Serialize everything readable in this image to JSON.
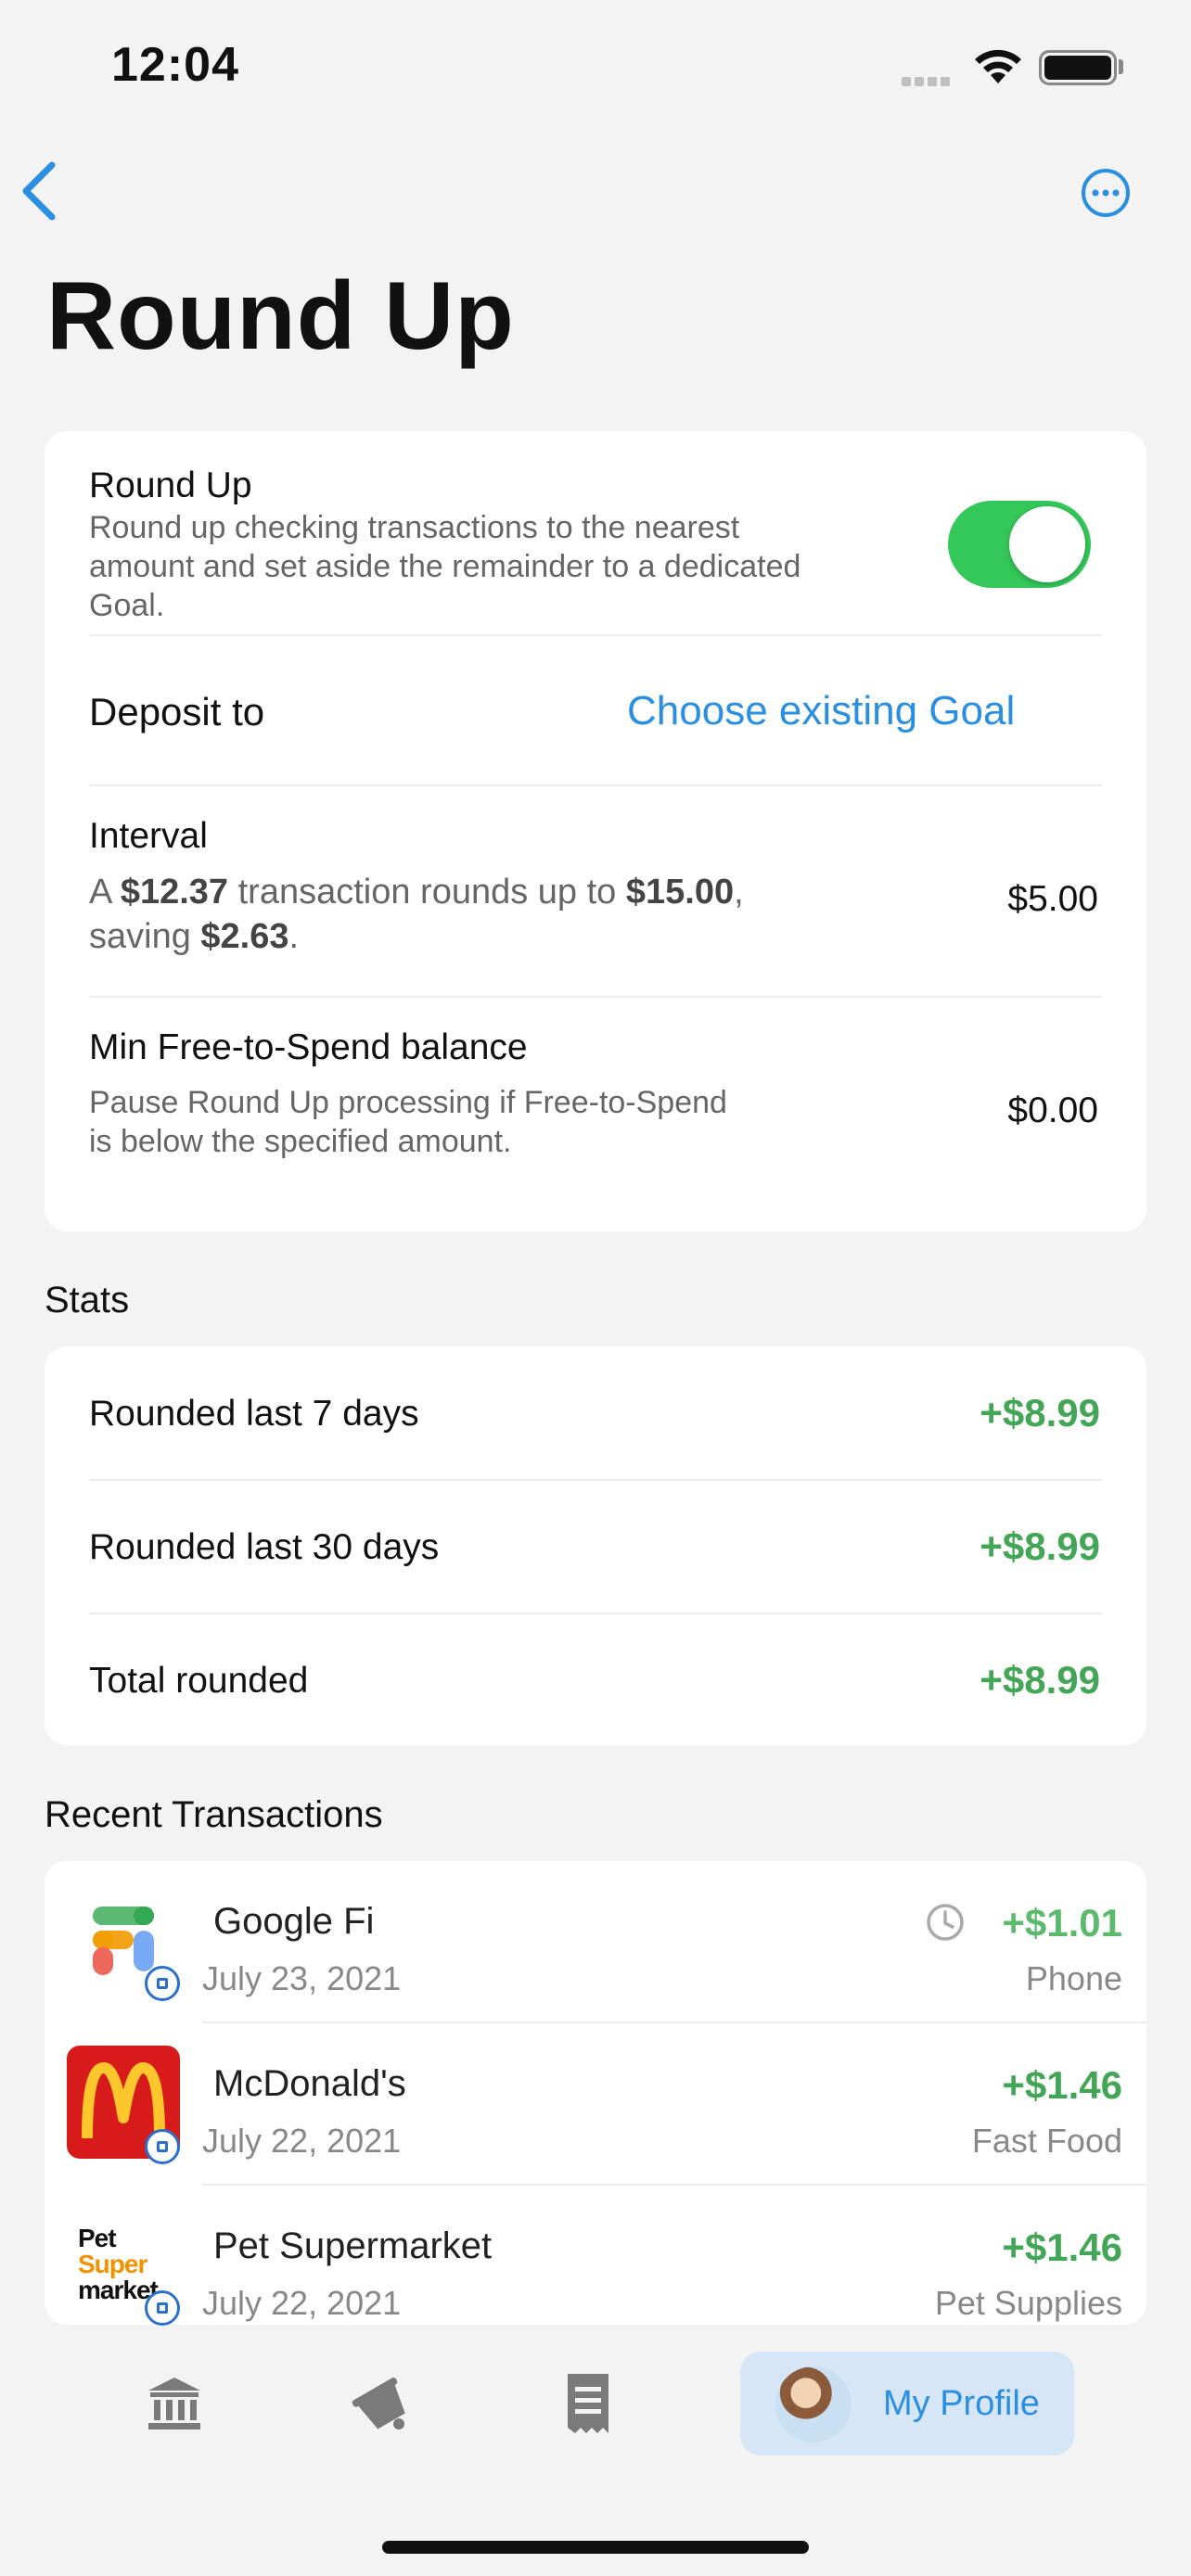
{
  "status_bar": {
    "time": "12:04"
  },
  "nav": {
    "title": "Round Up"
  },
  "settings": {
    "round_up_label": "Round Up",
    "round_up_desc_1": "Round up checking transactions to the nearest",
    "round_up_desc_2": "amount and set aside the remainder to a dedicated",
    "round_up_desc_3": "Goal.",
    "round_up_enabled": true,
    "deposit_label": "Deposit to",
    "deposit_link": "Choose existing Goal",
    "interval_label": "Interval",
    "interval_desc_a": "A",
    "interval_desc_amt1": "$12.37",
    "interval_desc_b": "transaction rounds up to",
    "interval_desc_amt2": "$15.00",
    "interval_desc_c": ",",
    "interval_desc_d": "saving",
    "interval_desc_amt3": "$2.63",
    "interval_desc_e": ".",
    "interval_value": "$5.00",
    "min_label": "Min Free-to-Spend balance",
    "min_desc_1": "Pause Round Up processing if Free-to-Spend",
    "min_desc_2": "is below the specified amount.",
    "min_value": "$0.00"
  },
  "stats": {
    "heading": "Stats",
    "rows": [
      {
        "label": "Rounded last 7 days",
        "value": "+$8.99"
      },
      {
        "label": "Rounded last 30 days",
        "value": "+$8.99"
      },
      {
        "label": "Total rounded",
        "value": "+$8.99"
      }
    ]
  },
  "transactions": {
    "heading": "Recent Transactions",
    "items": [
      {
        "name": "Google Fi",
        "date": "July 23, 2021",
        "amount": "+$1.01",
        "category": "Phone",
        "pending": true,
        "logo": "google-fi-logo"
      },
      {
        "name": "McDonald's",
        "date": "July 22, 2021",
        "amount": "+$1.46",
        "category": "Fast Food",
        "pending": false,
        "logo": "mcdonalds-logo"
      },
      {
        "name": "Pet Supermarket",
        "date": "July 22, 2021",
        "amount": "+$1.46",
        "category": "Pet Supplies",
        "pending": false,
        "logo": "pet-supermarket-logo",
        "logo_text": [
          "Pet",
          "Super",
          "market"
        ]
      }
    ]
  },
  "tab_bar": {
    "profile_label": "My Profile"
  },
  "colors": {
    "accent": "#2a8fe0",
    "positive": "#43a556",
    "toggle_on": "#34c759"
  }
}
